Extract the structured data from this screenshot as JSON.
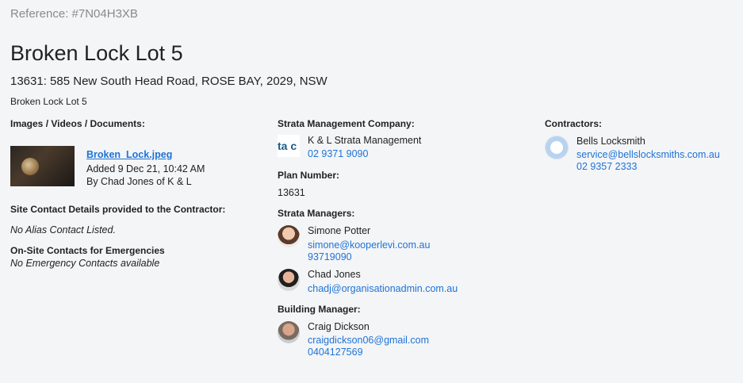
{
  "reference": "Reference: #7N04H3XB",
  "title": "Broken Lock Lot 5",
  "address": "13631: 585 New South Head Road, ROSE BAY, 2029, NSW",
  "description": "Broken Lock Lot 5",
  "media": {
    "label": "Images / Videos / Documents:",
    "file_name": "Broken_Lock.jpeg",
    "added": "Added 9 Dec 21, 10:42 AM",
    "by": "By Chad Jones of K & L"
  },
  "site_contact": {
    "label": "Site Contact Details provided to the Contractor:",
    "value": "No Alias Contact Listed."
  },
  "emergency": {
    "label": "On-Site Contacts for Emergencies",
    "value": "No Emergency Contacts available"
  },
  "strata_company": {
    "label": "Strata Management Company:",
    "logo_text": "ta c",
    "name": "K & L Strata Management",
    "phone": "02 9371 9090"
  },
  "plan": {
    "label": "Plan Number:",
    "value": "13631"
  },
  "strata_managers": {
    "label": "Strata Managers:",
    "people": [
      {
        "name": "Simone Potter",
        "email": "simone@kooperlevi.com.au",
        "phone": "93719090"
      },
      {
        "name": "Chad Jones",
        "email": "chadj@organisationadmin.com.au"
      }
    ]
  },
  "building_manager": {
    "label": "Building Manager:",
    "name": "Craig Dickson",
    "email": "craigdickson06@gmail.com",
    "phone": "0404127569"
  },
  "contractors": {
    "label": "Contractors:",
    "name": "Bells Locksmith",
    "email": "service@bellslocksmiths.com.au",
    "phone": "02 9357 2333"
  }
}
